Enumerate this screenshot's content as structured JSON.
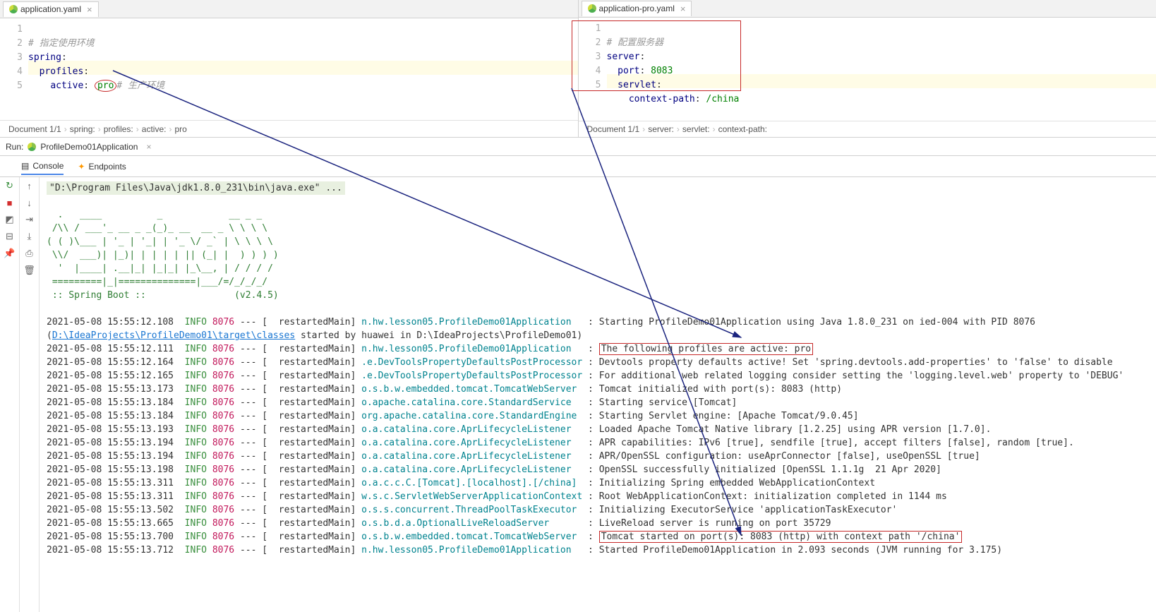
{
  "left": {
    "tab": "application.yaml",
    "lines": [
      "1",
      "2",
      "3",
      "4",
      "5"
    ],
    "code": {
      "c1": "# 指定使用环境",
      "k_spring": "spring",
      "k_profiles": "profiles",
      "k_active": "active",
      "v_active": "pro",
      "c2": "# 生产环境"
    },
    "crumbs": [
      "Document 1/1",
      "spring:",
      "profiles:",
      "active:",
      "pro"
    ]
  },
  "right": {
    "tab": "application-pro.yaml",
    "lines": [
      "1",
      "2",
      "3",
      "4",
      "5"
    ],
    "code": {
      "c1": "# 配置服务器",
      "k_server": "server",
      "k_port": "port",
      "v_port": "8083",
      "k_servlet": "servlet",
      "k_context": "context-path",
      "v_context": "/china"
    },
    "crumbs": [
      "Document 1/1",
      "server:",
      "servlet:",
      "context-path:"
    ]
  },
  "run": {
    "label": "Run:",
    "config": "ProfileDemo01Application",
    "tabs": {
      "console": "Console",
      "endpoints": "Endpoints"
    }
  },
  "console": {
    "cmd": "\"D:\\Program Files\\Java\\jdk1.8.0_231\\bin\\java.exe\" ...",
    "banner": [
      "  .   ____          _            __ _ _",
      " /\\\\ / ___'_ __ _ _(_)_ __  __ _ \\ \\ \\ \\",
      "( ( )\\___ | '_ | '_| | '_ \\/ _` | \\ \\ \\ \\",
      " \\\\/  ___)| |_)| | | | | || (_| |  ) ) ) )",
      "  '  |____| .__|_| |_|_| |_\\__, | / / / /",
      " =========|_|==============|___/=/_/_/_/"
    ],
    "boot": " :: Spring Boot ::                (v2.4.5)",
    "path_link": "D:\\IdeaProjects\\ProfileDemo01\\target\\classes",
    "path_rest": " started by huawei in D:\\IdeaProjects\\ProfileDemo01)",
    "hl1": "The following profiles are active: pro",
    "hl2": "Tomcat started on port(s): 8083 (http) with context path '/china'",
    "rows": [
      {
        "ts": "2021-05-08 15:55:12.108",
        "pid": "8076",
        "th": "restartedMain",
        "cls": "n.hw.lesson05.ProfileDemo01Application",
        "msg": "Starting ProfileDemo01Application using Java 1.8.0_231 on ied-004 with PID 8076"
      },
      {
        "ts": "2021-05-08 15:55:12.111",
        "pid": "8076",
        "th": "restartedMain",
        "cls": "n.hw.lesson05.ProfileDemo01Application",
        "msg": "HL1"
      },
      {
        "ts": "2021-05-08 15:55:12.164",
        "pid": "8076",
        "th": "restartedMain",
        "cls": ".e.DevToolsPropertyDefaultsPostProcessor",
        "msg": "Devtools property defaults active! Set 'spring.devtools.add-properties' to 'false' to disable"
      },
      {
        "ts": "2021-05-08 15:55:12.165",
        "pid": "8076",
        "th": "restartedMain",
        "cls": ".e.DevToolsPropertyDefaultsPostProcessor",
        "msg": "For additional web related logging consider setting the 'logging.level.web' property to 'DEBUG'"
      },
      {
        "ts": "2021-05-08 15:55:13.173",
        "pid": "8076",
        "th": "restartedMain",
        "cls": "o.s.b.w.embedded.tomcat.TomcatWebServer",
        "msg": "Tomcat initialized with port(s): 8083 (http)"
      },
      {
        "ts": "2021-05-08 15:55:13.184",
        "pid": "8076",
        "th": "restartedMain",
        "cls": "o.apache.catalina.core.StandardService",
        "msg": "Starting service [Tomcat]"
      },
      {
        "ts": "2021-05-08 15:55:13.184",
        "pid": "8076",
        "th": "restartedMain",
        "cls": "org.apache.catalina.core.StandardEngine",
        "msg": "Starting Servlet engine: [Apache Tomcat/9.0.45]"
      },
      {
        "ts": "2021-05-08 15:55:13.193",
        "pid": "8076",
        "th": "restartedMain",
        "cls": "o.a.catalina.core.AprLifecycleListener",
        "msg": "Loaded Apache Tomcat Native library [1.2.25] using APR version [1.7.0]."
      },
      {
        "ts": "2021-05-08 15:55:13.194",
        "pid": "8076",
        "th": "restartedMain",
        "cls": "o.a.catalina.core.AprLifecycleListener",
        "msg": "APR capabilities: IPv6 [true], sendfile [true], accept filters [false], random [true]."
      },
      {
        "ts": "2021-05-08 15:55:13.194",
        "pid": "8076",
        "th": "restartedMain",
        "cls": "o.a.catalina.core.AprLifecycleListener",
        "msg": "APR/OpenSSL configuration: useAprConnector [false], useOpenSSL [true]"
      },
      {
        "ts": "2021-05-08 15:55:13.198",
        "pid": "8076",
        "th": "restartedMain",
        "cls": "o.a.catalina.core.AprLifecycleListener",
        "msg": "OpenSSL successfully initialized [OpenSSL 1.1.1g  21 Apr 2020]"
      },
      {
        "ts": "2021-05-08 15:55:13.311",
        "pid": "8076",
        "th": "restartedMain",
        "cls": "o.a.c.c.C.[Tomcat].[localhost].[/china]",
        "msg": "Initializing Spring embedded WebApplicationContext"
      },
      {
        "ts": "2021-05-08 15:55:13.311",
        "pid": "8076",
        "th": "restartedMain",
        "cls": "w.s.c.ServletWebServerApplicationContext",
        "msg": "Root WebApplicationContext: initialization completed in 1144 ms"
      },
      {
        "ts": "2021-05-08 15:55:13.502",
        "pid": "8076",
        "th": "restartedMain",
        "cls": "o.s.s.concurrent.ThreadPoolTaskExecutor",
        "msg": "Initializing ExecutorService 'applicationTaskExecutor'"
      },
      {
        "ts": "2021-05-08 15:55:13.665",
        "pid": "8076",
        "th": "restartedMain",
        "cls": "o.s.b.d.a.OptionalLiveReloadServer",
        "msg": "LiveReload server is running on port 35729"
      },
      {
        "ts": "2021-05-08 15:55:13.700",
        "pid": "8076",
        "th": "restartedMain",
        "cls": "o.s.b.w.embedded.tomcat.TomcatWebServer",
        "msg": "HL2"
      },
      {
        "ts": "2021-05-08 15:55:13.712",
        "pid": "8076",
        "th": "restartedMain",
        "cls": "n.hw.lesson05.ProfileDemo01Application",
        "msg": "Started ProfileDemo01Application in 2.093 seconds (JVM running for 3.175)"
      }
    ]
  }
}
